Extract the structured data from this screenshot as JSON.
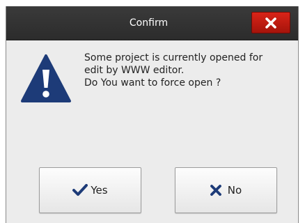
{
  "dialog": {
    "title": "Confirm",
    "close_icon": "close-x-icon",
    "warning_icon": "warning-triangle-icon",
    "message_lines": [
      "Some project is currently opened for",
      "edit by WWW editor.",
      "Do You want to force open ?"
    ],
    "yes_label": "Yes",
    "yes_icon": "checkmark-icon",
    "no_label": "No",
    "no_icon": "x-mark-icon"
  },
  "colors": {
    "titlebar": "#2f2f2f",
    "close_button": "#c41c11",
    "icon_blue": "#1d3b78"
  }
}
